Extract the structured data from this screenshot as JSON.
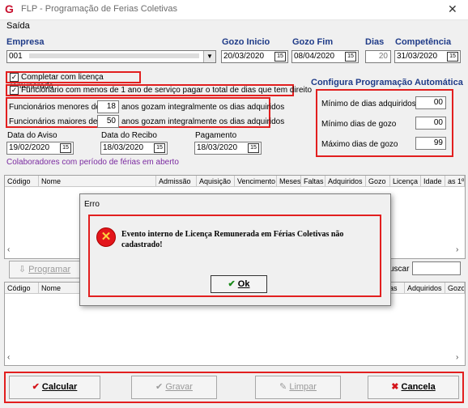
{
  "window": {
    "title": "FLP - Programação de Ferias Coletivas",
    "logo": "G",
    "close": "✕"
  },
  "menu": {
    "item": "Saída"
  },
  "labels": {
    "empresa": "Empresa",
    "gozo_inicio": "Gozo Inicio",
    "gozo_fim": "Gozo Fim",
    "dias": "Dias",
    "competencia": "Competência",
    "data_aviso": "Data do Aviso",
    "data_recibo": "Data do Recibo",
    "pagamento": "Pagamento",
    "colaboradores": "Colaboradores com período de férias em aberto",
    "auto_title": "Configura Programação Automática",
    "min_adq": "Mínimo de dias adquiridos",
    "min_gozo": "Mínimo dias de gozo",
    "max_gozo": "Máximo dias de gozo",
    "menores_pre": "Funcionários menores de",
    "menores_post": "anos gozam integralmente os dias adquiridos",
    "maiores_pre": "Funcionários  maiores de",
    "maiores_post": "anos gozam integralmente os dias adquiridos",
    "buscar": "uscar"
  },
  "fields": {
    "empresa": "001",
    "gozo_inicio": "20/03/2020",
    "gozo_fim": "08/04/2020",
    "dias": "20",
    "competencia": "31/03/2020",
    "data_aviso": "19/02/2020",
    "data_recibo": "18/03/2020",
    "pagamento": "18/03/2020",
    "menores": "18",
    "maiores": "50",
    "min_adq": "00",
    "min_gozo": "00",
    "max_gozo": "99"
  },
  "checks": {
    "licenca": "Completar com licença remunerada",
    "menos_1_ano": "Funcionario com menos de 1 ano de serviço pagar o total de dias que tem direito"
  },
  "grid1": {
    "headers": [
      "Código",
      "Nome",
      "Admissão",
      "Aquisição",
      "Vencimento",
      "Meses",
      "Faltas",
      "Adquiridos",
      "Gozo",
      "Licença",
      "Idade",
      "as 1ºO"
    ]
  },
  "grid2": {
    "headers": [
      "Código",
      "Nome",
      "as",
      "Adquiridos",
      "Gozo"
    ]
  },
  "programar": "Programar",
  "buttons": {
    "calcular": "Calcular",
    "gravar": "Gravar",
    "limpar": "Limpar",
    "cancela": "Cancela"
  },
  "dialog": {
    "title": "Erro",
    "message": "Evento interno de Licença Remunerada em Férias Coletivas não cadastrado!",
    "ok": "Ok"
  },
  "colors": {
    "accent_red": "#e21f1f",
    "label_blue": "#1f3b88",
    "purple_text": "#7a2aa0"
  }
}
